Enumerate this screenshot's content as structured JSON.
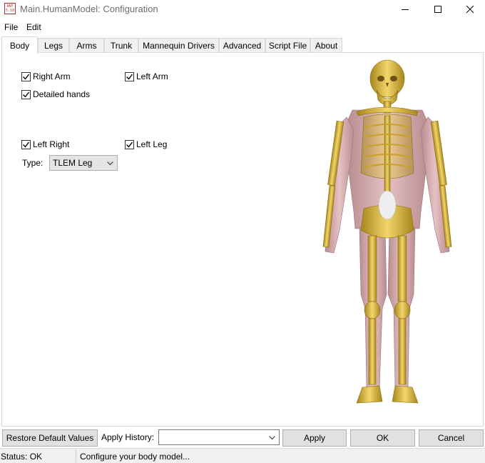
{
  "window": {
    "title": "Main.HumanModel: Configuration",
    "icon_text": "ANY 5.10",
    "icons": {
      "minimize": "minimize-icon",
      "maximize": "maximize-icon",
      "close": "close-icon"
    }
  },
  "menu": [
    "File",
    "Edit"
  ],
  "tabs": [
    {
      "label": "Body",
      "active": true
    },
    {
      "label": "Legs"
    },
    {
      "label": "Arms"
    },
    {
      "label": "Trunk"
    },
    {
      "label": "Mannequin Drivers"
    },
    {
      "label": "Advanced"
    },
    {
      "label": "Script File"
    },
    {
      "label": "About"
    }
  ],
  "body": {
    "right_arm": {
      "label": "Right Arm",
      "checked": true
    },
    "left_arm": {
      "label": "Left Arm",
      "checked": true
    },
    "detailed_hands": {
      "label": "Detailed hands",
      "checked": true
    },
    "left_right": {
      "label": "Left Right",
      "checked": true
    },
    "left_leg": {
      "label": "Left Leg",
      "checked": true
    },
    "type_label": "Type:",
    "type_value": "TLEM Leg"
  },
  "buttons": {
    "restore": "Restore Default Values",
    "apply_history_label": "Apply History:",
    "apply_history_value": "",
    "apply": "Apply",
    "ok": "OK",
    "cancel": "Cancel"
  },
  "status": {
    "state": "Status: OK",
    "message": "Configure your body model..."
  },
  "colors": {
    "bone": "#d9b640",
    "muscle": "#d9aeb0",
    "border": "#d9d9d9",
    "button_face": "#e1e1e1"
  }
}
